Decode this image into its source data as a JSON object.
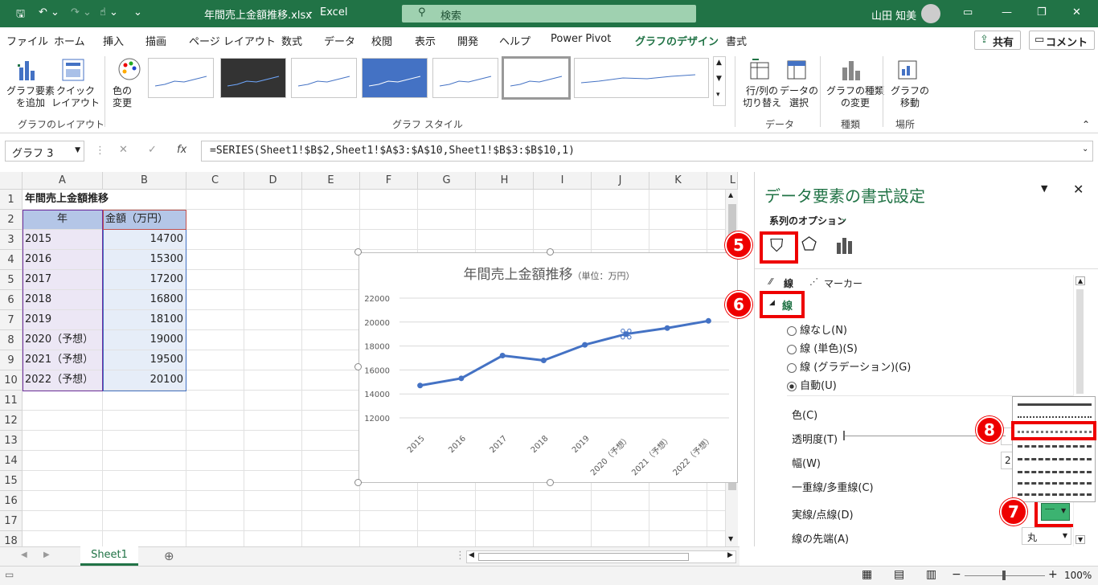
{
  "titlebar": {
    "filename": "年間売上金額推移.xlsx",
    "app": "Excel",
    "search_placeholder": "検索",
    "user": "山田 知美"
  },
  "menu": {
    "tabs": [
      "ファイル",
      "ホーム",
      "挿入",
      "描画",
      "ページ レイアウト",
      "数式",
      "データ",
      "校閲",
      "表示",
      "開発",
      "ヘルプ",
      "Power Pivot",
      "グラフのデザイン",
      "書式"
    ],
    "active_tab": "グラフのデザイン",
    "share": "共有",
    "comment": "コメント"
  },
  "ribbon": {
    "add_element": "グラフ要素\nを追加",
    "quick_layout": "クイック\nレイアウト",
    "change_color": "色の\n変更",
    "group_layout": "グラフのレイアウト",
    "group_styles": "グラフ スタイル",
    "switch_row_col": "行/列の\n切り替え",
    "select_data": "データの\n選択",
    "group_data": "データ",
    "change_type": "グラフの種類\nの変更",
    "group_type": "種類",
    "move_chart": "グラフの\n移動",
    "group_location": "場所"
  },
  "formula": {
    "name_box": "グラフ 3",
    "formula": "=SERIES(Sheet1!$B$2,Sheet1!$A$3:$A$10,Sheet1!$B$3:$B$10,1)"
  },
  "sheet": {
    "columns": [
      "A",
      "B",
      "C",
      "D",
      "E",
      "F",
      "G",
      "H",
      "I",
      "J",
      "K",
      "L"
    ],
    "rows": [
      "1",
      "2",
      "3",
      "4",
      "5",
      "6",
      "7",
      "8",
      "9",
      "10",
      "11",
      "12",
      "13",
      "14",
      "15",
      "16",
      "17",
      "18"
    ],
    "title": "年間売上金額推移",
    "header_year": "年",
    "header_amount": "金額（万円）",
    "data": [
      {
        "year": "2015",
        "amount": "14700"
      },
      {
        "year": "2016",
        "amount": "15300"
      },
      {
        "year": "2017",
        "amount": "17200"
      },
      {
        "year": "2018",
        "amount": "16800"
      },
      {
        "year": "2019",
        "amount": "18100"
      },
      {
        "year": "2020（予想）",
        "amount": "19000"
      },
      {
        "year": "2021（予想）",
        "amount": "19500"
      },
      {
        "year": "2022（予想）",
        "amount": "20100"
      }
    ],
    "tab_name": "Sheet1"
  },
  "chart_data": {
    "type": "line",
    "title": "年間売上金額推移",
    "subtitle": "（単位：万円）",
    "categories": [
      "2015",
      "2016",
      "2017",
      "2018",
      "2019",
      "2020（予想）",
      "2021（予想）",
      "2022（予想）"
    ],
    "values": [
      14700,
      15300,
      17200,
      16800,
      18100,
      19000,
      19500,
      20100
    ],
    "y_ticks": [
      "12000",
      "14000",
      "16000",
      "18000",
      "20000",
      "22000"
    ],
    "ylim": [
      12000,
      22000
    ],
    "line_color": "#4472c4",
    "grid": true,
    "selected_point_index": 5
  },
  "pane": {
    "title": "データ要素の書式設定",
    "series_options": "系列のオプション",
    "tab_line": "線",
    "tab_marker": "マーカー",
    "section_line": "線",
    "radio_none": "線なし(N)",
    "radio_solid": "線 (単色)(S)",
    "radio_gradient": "線 (グラデーション)(G)",
    "radio_auto": "自動(U)",
    "color": "色(C)",
    "transparency": "透明度(T)",
    "width": "幅(W)",
    "width_value": "2",
    "compound": "一重線/多重線(C)",
    "dash": "実線/点線(D)",
    "cap": "線の先端(A)",
    "cap_value": "丸"
  },
  "callouts": [
    "5",
    "6",
    "7",
    "8"
  ],
  "status": {
    "zoom": "100%"
  }
}
